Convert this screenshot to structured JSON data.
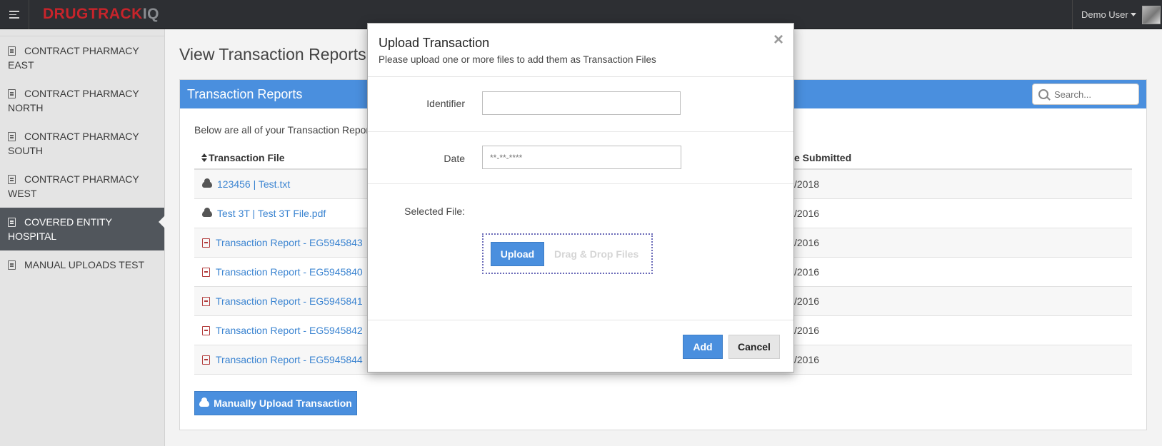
{
  "header": {
    "logo_part1": "DRUG",
    "logo_part2": "TRACK",
    "logo_part3": "IQ",
    "user_name": "Demo User",
    "brand_color": "#c8242b"
  },
  "sidebar": {
    "items": [
      {
        "label": "CONTRACT PHARMACY EAST",
        "active": false
      },
      {
        "label": "CONTRACT PHARMACY NORTH",
        "active": false
      },
      {
        "label": "CONTRACT PHARMACY SOUTH",
        "active": false
      },
      {
        "label": "CONTRACT PHARMACY WEST",
        "active": false
      },
      {
        "label": "COVERED ENTITY HOSPITAL",
        "active": true
      },
      {
        "label": "MANUAL UPLOADS TEST",
        "active": false
      }
    ]
  },
  "main": {
    "page_title": "View Transaction Reports",
    "panel_title": "Transaction Reports",
    "search_placeholder": "Search...",
    "description": "Below are all of your Transaction Repor",
    "columns": [
      "Transaction File",
      "e Submitted"
    ],
    "rows": [
      {
        "file": "123456 | Test.txt",
        "date": "/2018",
        "icon": "cloud-download-icon"
      },
      {
        "file": "Test 3T | Test 3T File.pdf",
        "date": "/2016",
        "icon": "cloud-download-icon"
      },
      {
        "file": "Transaction Report - EG5945843",
        "date": "/2016",
        "icon": "pdf-file-icon"
      },
      {
        "file": "Transaction Report - EG5945840",
        "date": "/2016",
        "icon": "pdf-file-icon"
      },
      {
        "file": "Transaction Report - EG5945841",
        "date": "/2016",
        "icon": "pdf-file-icon"
      },
      {
        "file": "Transaction Report - EG5945842",
        "date": "/2016",
        "icon": "pdf-file-icon"
      },
      {
        "file": "Transaction Report - EG5945844",
        "date": "/2016",
        "icon": "pdf-file-icon"
      }
    ],
    "manual_upload_label": "Manually Upload Transaction",
    "accent_color": "#4a8fde"
  },
  "modal": {
    "title": "Upload Transaction",
    "subtitle": "Please upload one or more files to add them as Transaction Files",
    "close_glyph": "×",
    "identifier_label": "Identifier",
    "identifier_value": "",
    "date_label": "Date",
    "date_placeholder": "**-**-****",
    "selected_file_label": "Selected File:",
    "upload_label": "Upload",
    "drop_text": "Drag & Drop Files",
    "add_label": "Add",
    "cancel_label": "Cancel"
  }
}
